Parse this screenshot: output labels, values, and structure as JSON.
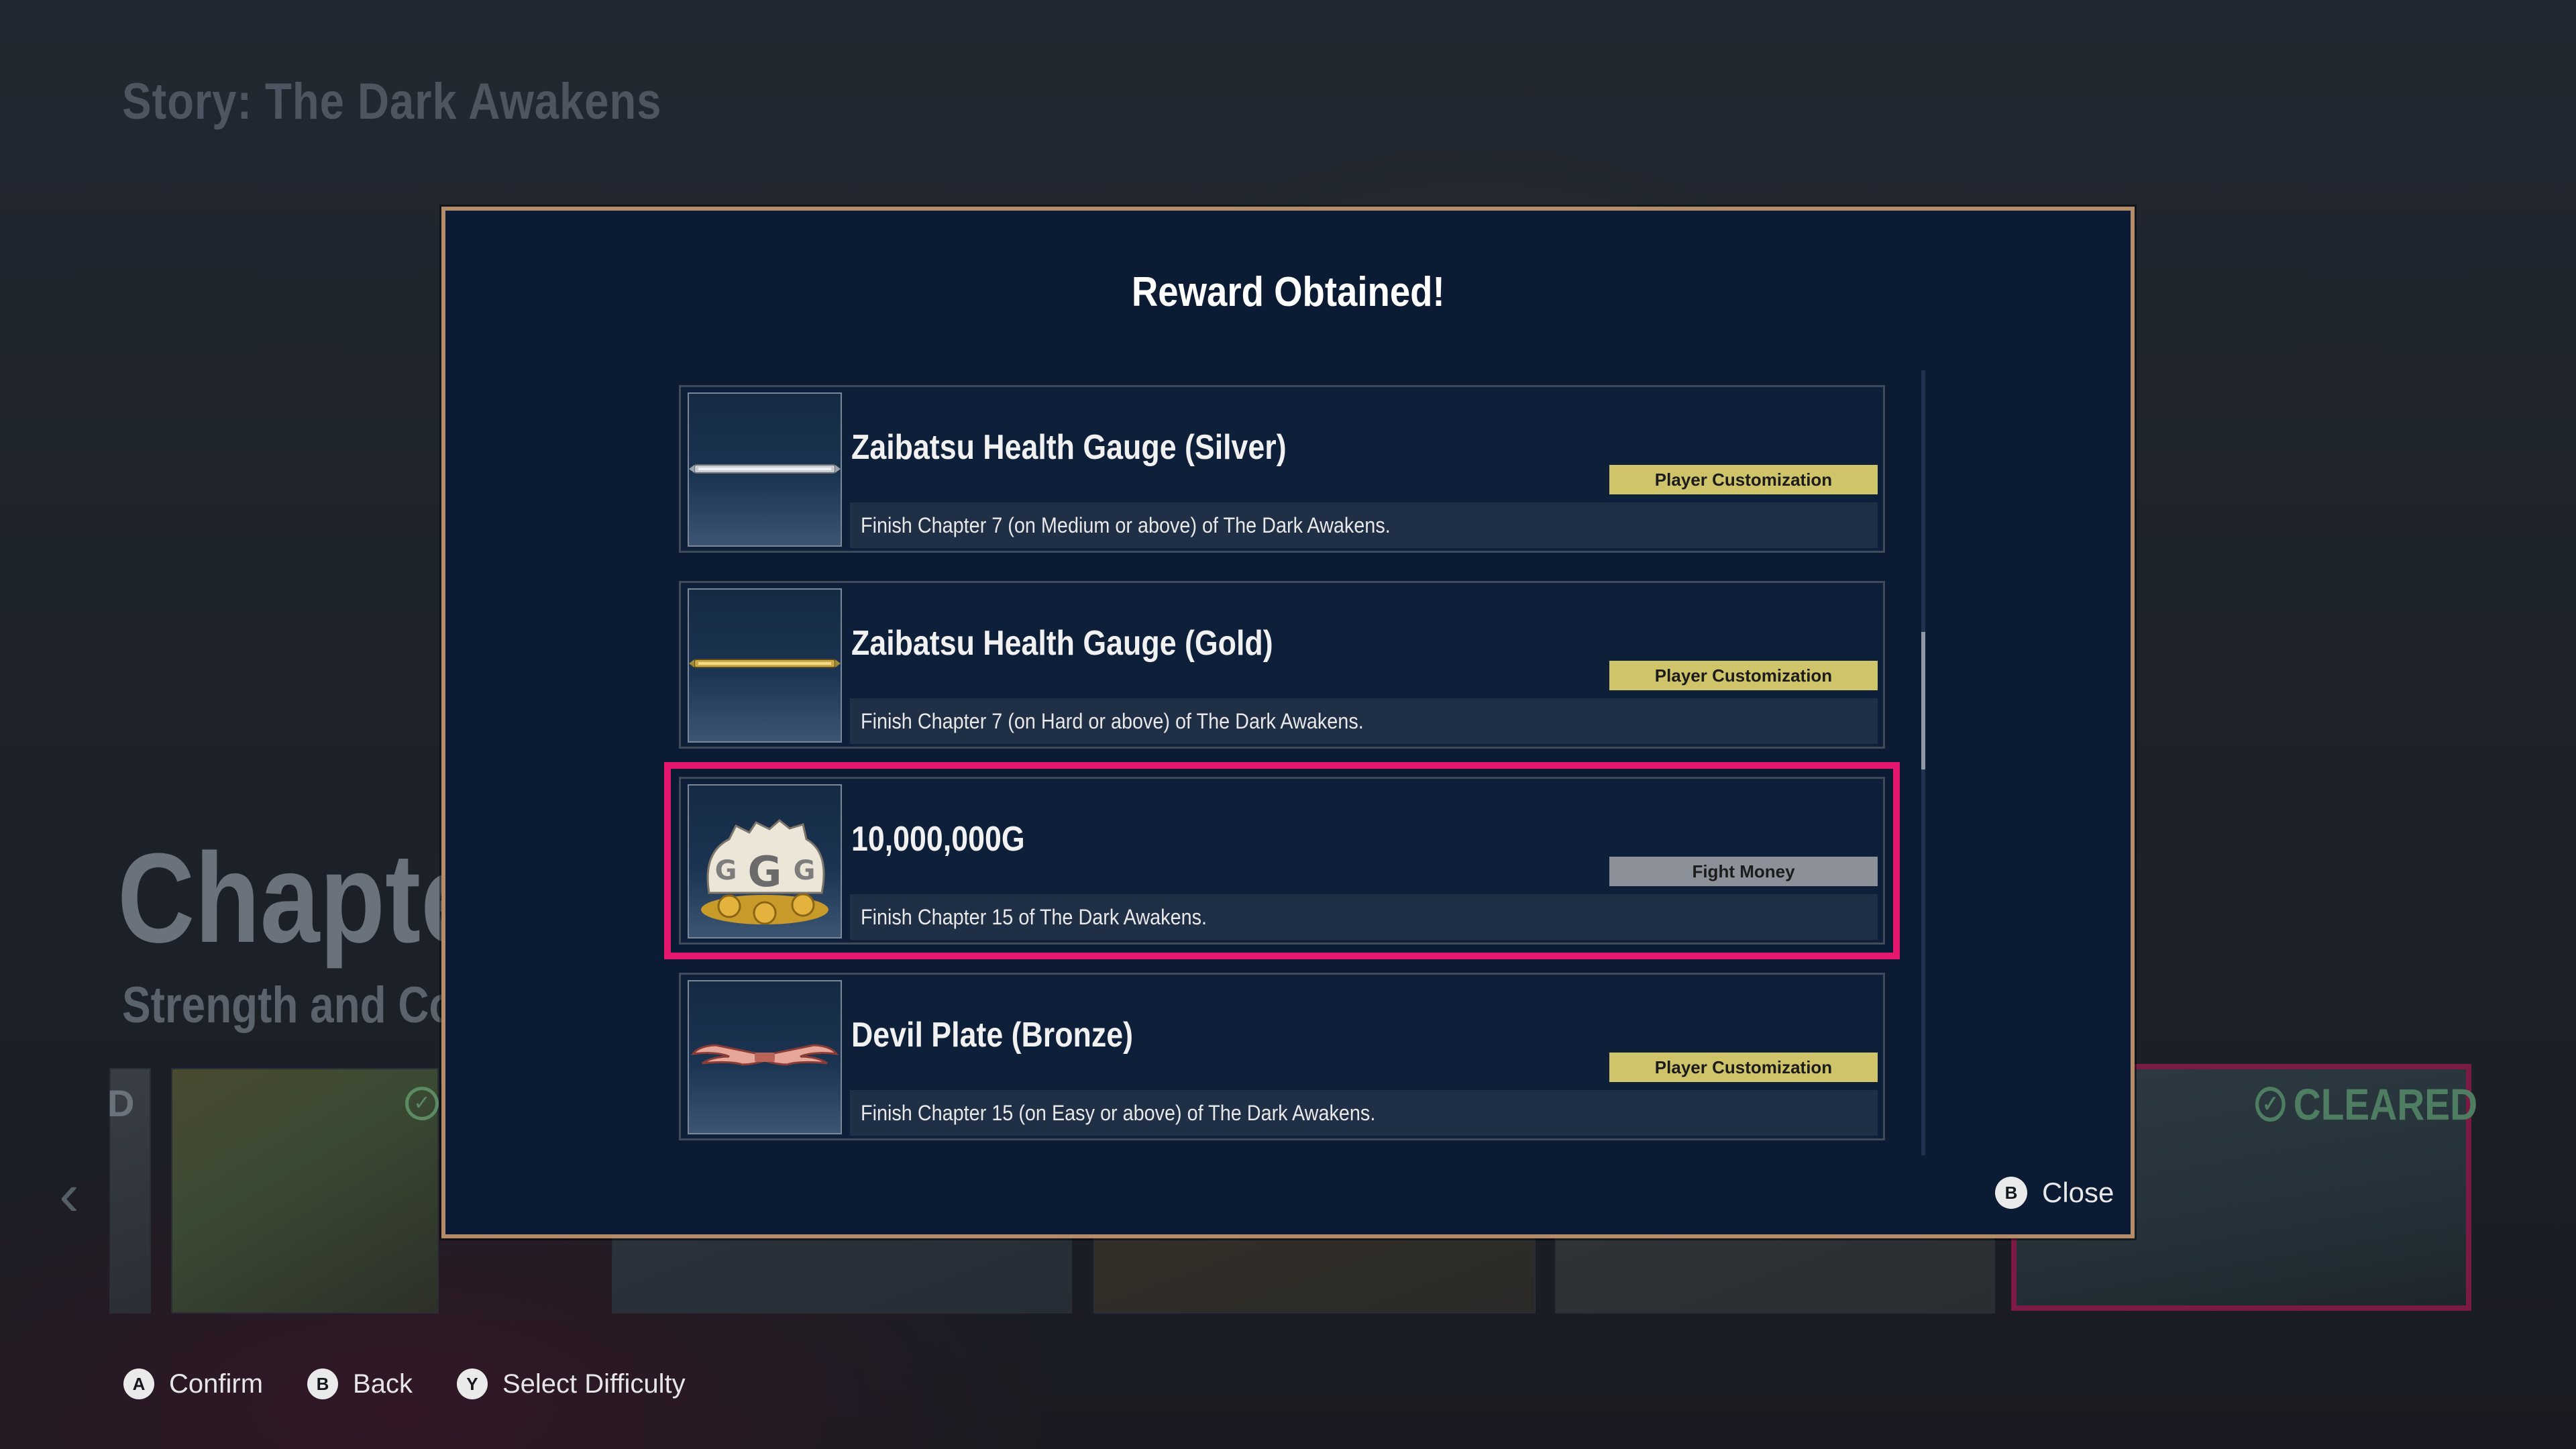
{
  "background": {
    "story_title": "Story: The Dark Awakens",
    "chapter_heading": "Chapte",
    "chapter_subtitle": "Strength and Co",
    "thumb_partial_label": "D",
    "cleared_label": "CLEARED"
  },
  "modal": {
    "title": "Reward Obtained!",
    "rewards": [
      {
        "name": "Zaibatsu Health Gauge (Silver)",
        "category": "Player Customization",
        "description": "Finish Chapter 7 (on Medium or above) of The Dark Awakens.",
        "icon": "silver-health-gauge-icon"
      },
      {
        "name": "Zaibatsu Health Gauge (Gold)",
        "category": "Player Customization",
        "description": "Finish Chapter 7 (on Hard or above) of The Dark Awakens.",
        "icon": "gold-health-gauge-icon"
      },
      {
        "name": "10,000,000G",
        "category": "Fight Money",
        "description": "Finish Chapter 15 of The Dark Awakens.",
        "icon": "money-bags-icon",
        "selected": true
      },
      {
        "name": "Devil Plate (Bronze)",
        "category": "Player Customization",
        "description": "Finish Chapter 15 (on Easy or above) of The Dark Awakens.",
        "icon": "devil-wings-plate-icon"
      }
    ],
    "close": {
      "button": "B",
      "label": "Close"
    }
  },
  "footer": {
    "hints": [
      {
        "button": "A",
        "label": "Confirm"
      },
      {
        "button": "B",
        "label": "Back"
      },
      {
        "button": "Y",
        "label": "Select Difficulty"
      }
    ]
  },
  "colors": {
    "modal_bg": "#0b1b33",
    "modal_border": "#b38c6b",
    "selection": "#e5176f",
    "customization_tag": "#cfc46a",
    "fight_money_tag": "#8c9098"
  }
}
